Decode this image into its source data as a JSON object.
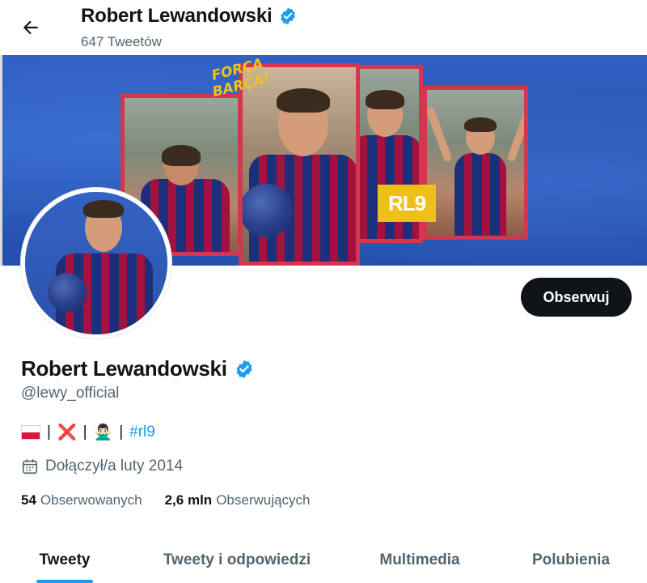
{
  "header": {
    "title": "Robert Lewandowski",
    "tweet_count": "647 Tweetów"
  },
  "banner": {
    "forca_text": "FORÇA BARÇA!",
    "rl9_text": "RL9"
  },
  "profile": {
    "name": "Robert Lewandowski",
    "handle": "@lewy_official",
    "verified": true,
    "bio": {
      "emoji_cross": "❌",
      "emoji_person": "🙅🏻‍♂️",
      "separator": "|",
      "hashtag": "#rl9"
    },
    "joined": "Dołączył/a luty 2014",
    "following_count": "54",
    "following_label": "Obserwowanych",
    "followers_count": "2,6 mln",
    "followers_label": "Obserwujących",
    "follow_button": "Obserwuj"
  },
  "tabs": [
    {
      "label": "Tweety",
      "active": true
    },
    {
      "label": "Tweety i odpowiedzi",
      "active": false
    },
    {
      "label": "Multimedia",
      "active": false
    },
    {
      "label": "Polubienia",
      "active": false
    }
  ],
  "colors": {
    "accent": "#1d9bf0",
    "text_primary": "#0f1419",
    "text_secondary": "#536471",
    "banner_blue": "#2a57b5",
    "frame_red": "#d3364f",
    "rl9_yellow": "#f0c01a"
  },
  "icons": {
    "back": "arrow-left-icon",
    "verified": "verified-badge-icon",
    "calendar": "calendar-icon"
  }
}
